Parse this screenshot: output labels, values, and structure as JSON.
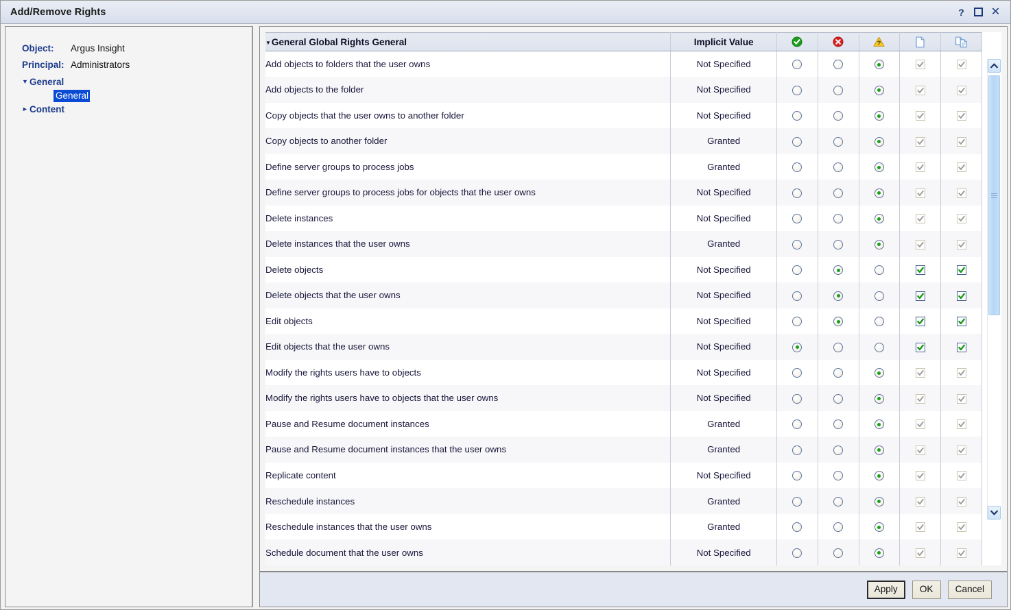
{
  "window": {
    "title": "Add/Remove Rights",
    "controls": [
      {
        "name": "help-button",
        "glyph": "?"
      },
      {
        "name": "maximize-button",
        "glyph": ""
      },
      {
        "name": "close-button",
        "glyph": "✕"
      }
    ]
  },
  "left_panel": {
    "object_label": "Object:",
    "object_value": "Argus Insight",
    "principal_label": "Principal:",
    "principal_value": "Administrators",
    "tree": [
      {
        "label": "General",
        "expanded": true,
        "arrow": "▼"
      },
      {
        "label": "General",
        "selected": true,
        "child": true
      },
      {
        "label": "Content",
        "expanded": false,
        "arrow": "►"
      }
    ]
  },
  "grid": {
    "sort_caret": "▼",
    "columns": {
      "name": "General Global Rights General",
      "implicit": "Implicit Value",
      "granted_icon": "granted-check-icon",
      "denied_icon": "denied-cross-icon",
      "not_specified_icon": "not-specified-warning-icon",
      "apply_to_object_icon": "document-page-icon",
      "apply_to_children_icon": "copy-documents-icon"
    },
    "rows": [
      {
        "name": "Add objects to folders that the user owns",
        "implicit": "Not Specified",
        "radio": 2,
        "cb1": "disabled-checked",
        "cb2": "disabled-checked"
      },
      {
        "name": "Add objects to the folder",
        "implicit": "Not Specified",
        "radio": 2,
        "cb1": "disabled-checked",
        "cb2": "disabled-checked"
      },
      {
        "name": "Copy objects that the user owns to another folder",
        "implicit": "Not Specified",
        "radio": 2,
        "cb1": "disabled-checked",
        "cb2": "disabled-checked"
      },
      {
        "name": "Copy objects to another folder",
        "implicit": "Granted",
        "radio": 2,
        "cb1": "disabled-checked",
        "cb2": "disabled-checked"
      },
      {
        "name": "Define server groups to process jobs",
        "implicit": "Granted",
        "radio": 2,
        "cb1": "disabled-checked",
        "cb2": "disabled-checked"
      },
      {
        "name": "Define server groups to process jobs for objects that the user owns",
        "implicit": "Not Specified",
        "radio": 2,
        "cb1": "disabled-checked",
        "cb2": "disabled-checked"
      },
      {
        "name": "Delete instances",
        "implicit": "Not Specified",
        "radio": 2,
        "cb1": "disabled-checked",
        "cb2": "disabled-checked"
      },
      {
        "name": "Delete instances that the user owns",
        "implicit": "Granted",
        "radio": 2,
        "cb1": "disabled-checked",
        "cb2": "disabled-checked"
      },
      {
        "name": "Delete objects",
        "implicit": "Not Specified",
        "radio": 1,
        "cb1": "enabled-checked",
        "cb2": "enabled-checked"
      },
      {
        "name": "Delete objects that the user owns",
        "implicit": "Not Specified",
        "radio": 1,
        "cb1": "enabled-checked",
        "cb2": "enabled-checked"
      },
      {
        "name": "Edit objects",
        "implicit": "Not Specified",
        "radio": 1,
        "cb1": "enabled-checked",
        "cb2": "enabled-checked"
      },
      {
        "name": "Edit objects that the user owns",
        "implicit": "Not Specified",
        "radio": 0,
        "cb1": "enabled-checked",
        "cb2": "enabled-checked"
      },
      {
        "name": "Modify the rights users have to objects",
        "implicit": "Not Specified",
        "radio": 2,
        "cb1": "disabled-checked",
        "cb2": "disabled-checked"
      },
      {
        "name": "Modify the rights users have to objects that the user owns",
        "implicit": "Not Specified",
        "radio": 2,
        "cb1": "disabled-checked",
        "cb2": "disabled-checked"
      },
      {
        "name": "Pause and Resume document instances",
        "implicit": "Granted",
        "radio": 2,
        "cb1": "disabled-checked",
        "cb2": "disabled-checked"
      },
      {
        "name": "Pause and Resume document instances that the user owns",
        "implicit": "Granted",
        "radio": 2,
        "cb1": "disabled-checked",
        "cb2": "disabled-checked"
      },
      {
        "name": "Replicate content",
        "implicit": "Not Specified",
        "radio": 2,
        "cb1": "disabled-checked",
        "cb2": "disabled-checked"
      },
      {
        "name": "Reschedule instances",
        "implicit": "Granted",
        "radio": 2,
        "cb1": "disabled-checked",
        "cb2": "disabled-checked"
      },
      {
        "name": "Reschedule instances that the user owns",
        "implicit": "Granted",
        "radio": 2,
        "cb1": "disabled-checked",
        "cb2": "disabled-checked"
      },
      {
        "name": "Schedule document that the user owns",
        "implicit": "Not Specified",
        "radio": 2,
        "cb1": "disabled-checked",
        "cb2": "disabled-checked",
        "clipped": true
      }
    ]
  },
  "scrollbar": {
    "up_arrow": "scroll-up-icon",
    "down_arrow": "scroll-down-icon"
  },
  "footer": {
    "buttons": [
      {
        "label": "Apply",
        "name": "apply-button",
        "default": true
      },
      {
        "label": "OK",
        "name": "ok-button",
        "default": false
      },
      {
        "label": "Cancel",
        "name": "cancel-button",
        "default": false
      }
    ]
  },
  "colors": {
    "granted": "#1a9a1a",
    "denied": "#d41f1f",
    "warning": "#f5c518",
    "accent": "#1b3a8c",
    "selection": "#0a4bd6"
  }
}
